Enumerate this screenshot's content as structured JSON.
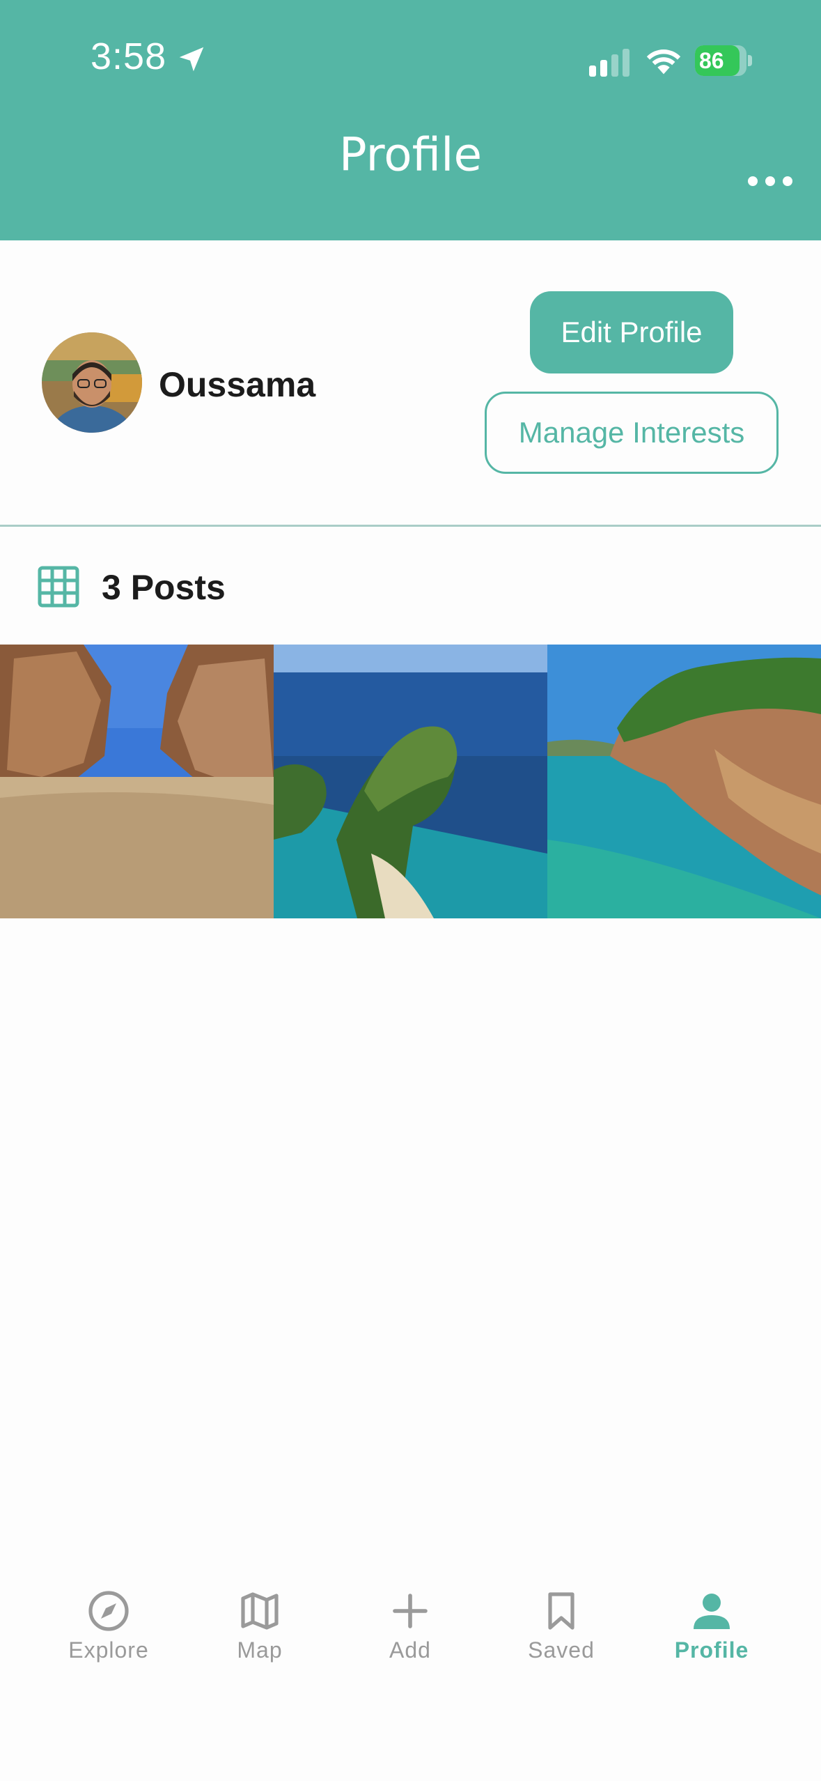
{
  "status_bar": {
    "time": "3:58",
    "battery": "86",
    "battery_level": 0.86
  },
  "header": {
    "title": "Profile",
    "more_icon": "ellipsis-horizontal-icon"
  },
  "profile": {
    "username": "Oussama",
    "edit_button": "Edit Profile",
    "interests_button": "Manage Interests"
  },
  "posts": {
    "count_label": "3 Posts",
    "items": [
      {
        "subject": "desert canyon"
      },
      {
        "subject": "cliff island above turquoise sea"
      },
      {
        "subject": "green coastal cliffs"
      }
    ]
  },
  "tabbar": {
    "items": [
      {
        "label": "Explore",
        "icon": "compass-icon"
      },
      {
        "label": "Map",
        "icon": "map-icon"
      },
      {
        "label": "Add",
        "icon": "plus-icon"
      },
      {
        "label": "Saved",
        "icon": "bookmark-icon"
      },
      {
        "label": "Profile",
        "icon": "person-icon"
      }
    ],
    "active": "Profile"
  },
  "colors": {
    "accent": "#55b6a5",
    "inactive": "#9a9a9a",
    "battery": "#34c759"
  }
}
